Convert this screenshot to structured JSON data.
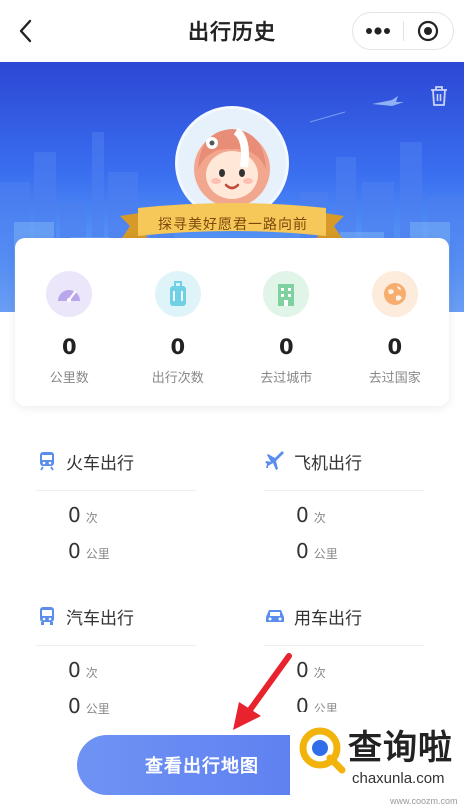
{
  "navbar": {
    "title": "出行历史",
    "back_icon": "chevron-left-icon",
    "more_icon": "more-dots-icon",
    "close_icon": "target-circle-icon"
  },
  "hero": {
    "slogan": "探寻美好愿君一路向前",
    "trash_icon": "trash-icon",
    "avatar_icon": "cartoon-girl-avatar"
  },
  "stats": [
    {
      "value": "0",
      "label": "公里数",
      "icon": "speedometer-icon",
      "color": "#b9a6ec"
    },
    {
      "value": "0",
      "label": "出行次数",
      "icon": "luggage-icon",
      "color": "#6fd0e6"
    },
    {
      "value": "0",
      "label": "去过城市",
      "icon": "building-icon",
      "color": "#7fd2a0"
    },
    {
      "value": "0",
      "label": "去过国家",
      "icon": "globe-icon",
      "color": "#f6ad6e"
    }
  ],
  "sections": {
    "train": {
      "title": "火车出行",
      "icon": "train-icon",
      "trips": "0",
      "trips_unit": "次",
      "distance": "0",
      "distance_unit": "公里"
    },
    "plane": {
      "title": "飞机出行",
      "icon": "plane-icon",
      "trips": "0",
      "trips_unit": "次",
      "distance": "0",
      "distance_unit": "公里"
    },
    "bus": {
      "title": "汽车出行",
      "icon": "bus-icon",
      "trips": "0",
      "trips_unit": "次",
      "distance": "0",
      "distance_unit": "公里"
    },
    "car": {
      "title": "用车出行",
      "icon": "car-icon",
      "trips": "0",
      "trips_unit": "次",
      "distance": "0",
      "distance_unit": "公里"
    }
  },
  "map_button": {
    "label": "查看出行地图"
  },
  "watermark": {
    "title": "查询啦",
    "subtitle": "chaxunla.com",
    "url": "www.coozm.com"
  },
  "colors": {
    "brand_blue": "#3a6ff0",
    "button_blue": "#6f93f4",
    "annotation_red": "#e8232d"
  }
}
